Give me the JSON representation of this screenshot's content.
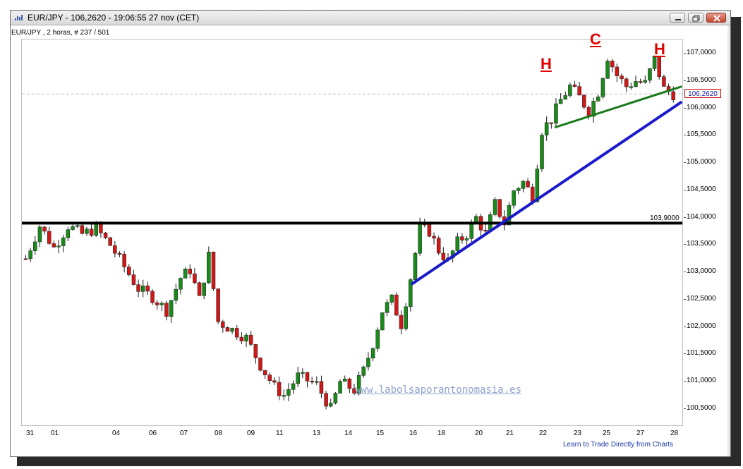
{
  "window": {
    "title": "EUR/JPY - 106,2620 - 19:06:55  27 nov (CET)",
    "subtitle": "EUR/JPY , 2 horas, # 237 / 501",
    "buttons": {
      "minimize": "minimize-icon",
      "maximize": "restore-icon",
      "close": "close-icon"
    }
  },
  "chart_data": {
    "type": "candlestick",
    "symbol": "EUR/JPY",
    "timeframe": "2 horas",
    "current_price": "106,2620",
    "horizontal_level": {
      "label": "103,9000",
      "value": 103.9
    },
    "ylim": [
      100.3,
      107.3
    ],
    "y_ticks": [
      "107,0000",
      "106,5000",
      "106,0000",
      "105,5000",
      "105,0000",
      "104,5000",
      "104,0000",
      "103,5000",
      "103,0000",
      "102,5000",
      "102,0000",
      "101,5000",
      "101,0000",
      "100,5000"
    ],
    "x_ticks": [
      "31",
      "01",
      "04",
      "06",
      "07",
      "08",
      "09",
      "11",
      "13",
      "14",
      "15",
      "16",
      "18",
      "20",
      "21",
      "22",
      "23",
      "25",
      "27",
      "28"
    ],
    "pattern_labels": [
      "H",
      "C",
      "H"
    ],
    "watermark": "www.labolsaporantonomasia.es",
    "footer_link": "Learn to Trade Directly from Charts",
    "colors": {
      "up": "#1a8a1a",
      "down": "#d01818",
      "level_line": "#000000",
      "support_line": "#1a1acc",
      "neckline": "#1a7a1a",
      "price_box_border": "#d00000",
      "pattern_text": "#e00000"
    },
    "trend_lines": [
      {
        "name": "support",
        "from": {
          "x_day_index": 11.6,
          "y": 102.78
        },
        "to": {
          "x_day_index": 19.9,
          "y": 106.12
        }
      },
      {
        "name": "neckline",
        "from": {
          "x_day_index": 16.0,
          "y": 105.65
        },
        "to": {
          "x_day_index": 19.9,
          "y": 106.4
        }
      }
    ],
    "path": [
      [
        0,
        103.25
      ],
      [
        3,
        103.85
      ],
      [
        6,
        103.45
      ],
      [
        9,
        103.85
      ],
      [
        12,
        103.7
      ],
      [
        15,
        103.8
      ],
      [
        18,
        103.5
      ],
      [
        21,
        103.1
      ],
      [
        24,
        102.7
      ],
      [
        27,
        102.55
      ],
      [
        30,
        102.3
      ],
      [
        33,
        102.9
      ],
      [
        35,
        103.05
      ],
      [
        37,
        102.5
      ],
      [
        39,
        103.3
      ],
      [
        41,
        102.1
      ],
      [
        44,
        101.95
      ],
      [
        47,
        101.8
      ],
      [
        50,
        101.3
      ],
      [
        53,
        100.9
      ],
      [
        55,
        100.75
      ],
      [
        58,
        101.1
      ],
      [
        62,
        100.95
      ],
      [
        65,
        100.5
      ],
      [
        67,
        101.0
      ],
      [
        70,
        100.85
      ],
      [
        72,
        101.2
      ],
      [
        74,
        101.7
      ],
      [
        76,
        102.3
      ],
      [
        78,
        102.5
      ],
      [
        80,
        102.05
      ],
      [
        82,
        102.9
      ],
      [
        84,
        103.8
      ],
      [
        86,
        103.75
      ],
      [
        88,
        103.4
      ],
      [
        90,
        103.2
      ],
      [
        92,
        103.55
      ],
      [
        94,
        103.7
      ],
      [
        96,
        104.0
      ],
      [
        98,
        103.7
      ],
      [
        100,
        104.25
      ],
      [
        102,
        103.9
      ],
      [
        104,
        104.5
      ],
      [
        106,
        104.65
      ],
      [
        108,
        104.4
      ],
      [
        110,
        105.6
      ],
      [
        112,
        105.8
      ],
      [
        114,
        106.15
      ],
      [
        116,
        106.4
      ],
      [
        118,
        106.2
      ],
      [
        120,
        105.95
      ],
      [
        122,
        106.3
      ],
      [
        124,
        106.95
      ],
      [
        126,
        106.6
      ],
      [
        128,
        106.4
      ],
      [
        130,
        106.5
      ],
      [
        132,
        106.45
      ],
      [
        134,
        106.9
      ],
      [
        136,
        106.35
      ],
      [
        138,
        106.26
      ]
    ]
  }
}
